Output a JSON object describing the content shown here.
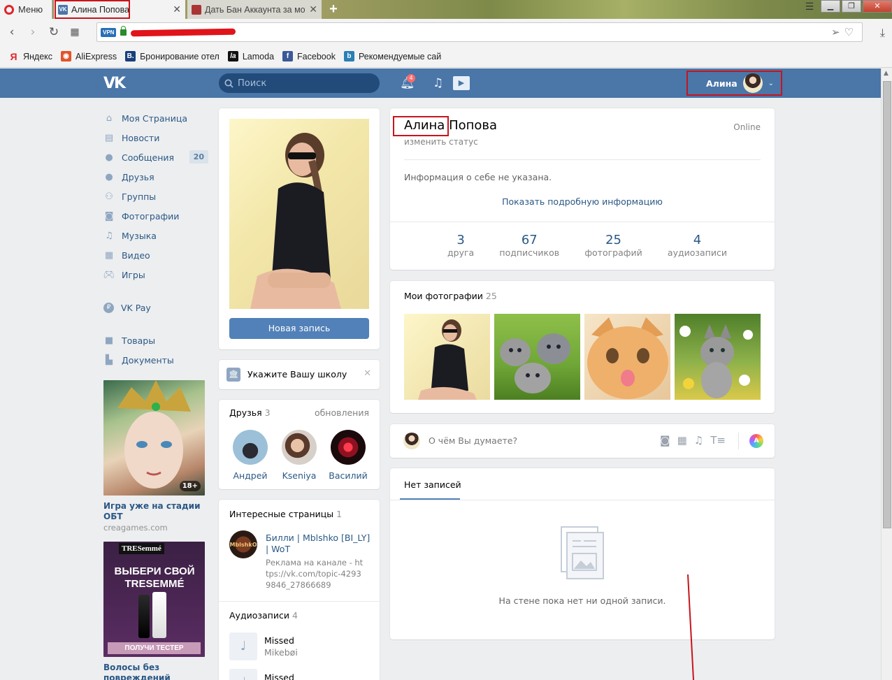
{
  "browser": {
    "menu_label": "Меню",
    "tabs": [
      {
        "title": "Алина Попова",
        "active": true
      },
      {
        "title": "Дать Бан Аккаунта за мо",
        "active": false
      }
    ],
    "vpn_badge": "VPN",
    "bookmarks": [
      {
        "label": "Яндекс",
        "icon": "Я",
        "color": "#e0262b"
      },
      {
        "label": "AliExpress",
        "icon": "◉",
        "color": "#e2542a"
      },
      {
        "label": "Бронирование отел",
        "icon": "B.",
        "color": "#1a3f7a"
      },
      {
        "label": "Lamoda",
        "icon": "la",
        "color": "#111111"
      },
      {
        "label": "Facebook",
        "icon": "f",
        "color": "#3b5998"
      },
      {
        "label": "Рекомендуемые сай",
        "icon": "b",
        "color": "#2a7fb5"
      }
    ]
  },
  "vk": {
    "logo": "VK",
    "search_placeholder": "Поиск",
    "notifications_count": "4",
    "user_name": "Алина",
    "accent": "#4a76a8"
  },
  "sidebar": {
    "items": [
      {
        "label": "Моя Страница",
        "icon": "home-icon"
      },
      {
        "label": "Новости",
        "icon": "news-icon"
      },
      {
        "label": "Сообщения",
        "icon": "messages-icon",
        "count": "20"
      },
      {
        "label": "Друзья",
        "icon": "friends-icon"
      },
      {
        "label": "Группы",
        "icon": "groups-icon"
      },
      {
        "label": "Фотографии",
        "icon": "camera-icon"
      },
      {
        "label": "Музыка",
        "icon": "music-icon"
      },
      {
        "label": "Видео",
        "icon": "video-icon"
      },
      {
        "label": "Игры",
        "icon": "games-icon"
      }
    ],
    "items2": [
      {
        "label": "VK Pay",
        "icon": "vkpay-icon"
      }
    ],
    "items3": [
      {
        "label": "Товары",
        "icon": "bag-icon"
      },
      {
        "label": "Документы",
        "icon": "document-icon"
      }
    ],
    "ads": [
      {
        "title": "Игра уже на стадии ОБТ",
        "sub": "creagames.com",
        "badge": "18+"
      },
      {
        "title": "Волосы без повреждений",
        "sub": "",
        "img_text1": "ВЫБЕРИ СВОЙ TRESEMMÉ",
        "img_text2": "ПОЛУЧИ ТЕСТЕР",
        "brand": "TRESemmé"
      }
    ]
  },
  "profile": {
    "new_post_button": "Новая запись",
    "school_prompt": "Укажите Вашу школу",
    "first_name": "Алина",
    "last_name": "Попова",
    "status_link": "изменить статус",
    "online": "Online",
    "about": "Информация о себе не указана.",
    "show_more": "Показать подробную информацию",
    "counters": [
      {
        "value": "3",
        "label": "друга"
      },
      {
        "value": "67",
        "label": "подписчиков"
      },
      {
        "value": "25",
        "label": "фотографий"
      },
      {
        "value": "4",
        "label": "аудиозаписи"
      }
    ]
  },
  "friends": {
    "title": "Друзья",
    "count": "3",
    "updates": "обновления",
    "list": [
      "Андрей",
      "Kseniya",
      "Василий"
    ]
  },
  "interesting": {
    "title": "Интересные страницы",
    "count": "1",
    "page_name": "Билли | Mblshko [BI_LY] | WoT",
    "page_desc": "Реклама на канале - https://vk.com/topic-42939846_27866689",
    "logo_text": "MblshkO"
  },
  "audio": {
    "title": "Аудиозаписи",
    "count": "4",
    "tracks": [
      {
        "title": "Missed",
        "artist": "Mikebøi"
      },
      {
        "title": "Missed",
        "artist": ""
      }
    ]
  },
  "photos": {
    "title": "Мои фотографии",
    "count": "25"
  },
  "composer": {
    "placeholder": "О чём Вы думаете?"
  },
  "wall": {
    "tab": "Нет записей",
    "empty": "На стене пока нет ни одной записи."
  }
}
